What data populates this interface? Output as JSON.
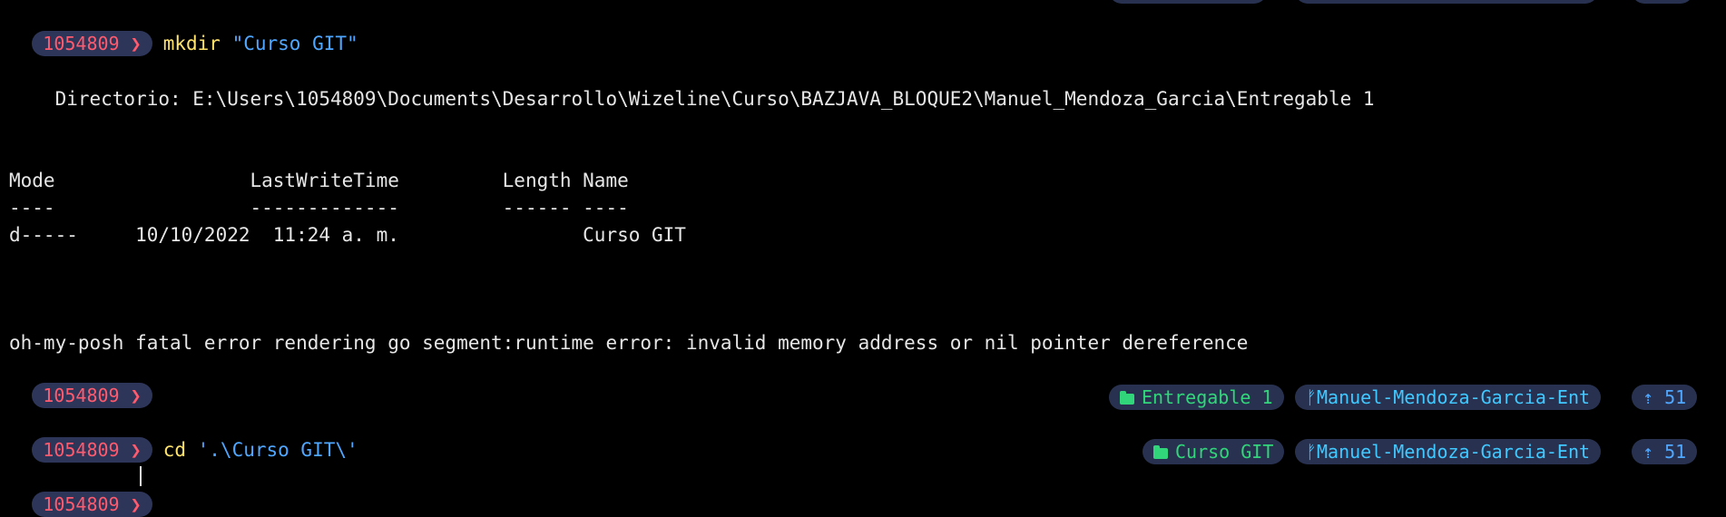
{
  "prompt": {
    "user": "1054809",
    "chevron": "❯"
  },
  "lines": {
    "cmd1": {
      "command": "mkdir",
      "arg": "\"Curso GIT\""
    },
    "directory": "    Directorio: E:\\Users\\1054809\\Documents\\Desarrollo\\Wizeline\\Curso\\BAZJAVA_BLOQUE2\\Manuel_Mendoza_Garcia\\Entregable 1",
    "table_header": "Mode                 LastWriteTime         Length Name",
    "table_sep": "----                 -------------         ------ ----",
    "table_row": "d-----     10/10/2022  11:24 a. m.                Curso GIT",
    "error": "oh-my-posh fatal error rendering go segment:runtime error: invalid memory address or nil pointer dereference",
    "cmd2": {
      "command": "cd",
      "arg": "'.\\Curso GIT\\'"
    }
  },
  "right_prompt_1": {
    "folder": "Entregable 1",
    "branch": "ᚠManuel-Mendoza-Garcia-Ent",
    "ahead": "⇡ 51"
  },
  "right_prompt_2": {
    "folder": "Curso GIT",
    "branch": "ᚠManuel-Mendoza-Garcia-Ent",
    "ahead": "⇡ 51"
  },
  "colors": {
    "prompt_bg": "#2d3559",
    "prompt_text": "#ff5b6e",
    "command": "#ffe36b",
    "argument": "#4fa7ff",
    "folder": "#32d67a",
    "branch": "#41c8ff"
  },
  "icons": {
    "folder": "folder-icon",
    "branch": "git-branch-icon",
    "ahead": "arrow-up-icon"
  }
}
